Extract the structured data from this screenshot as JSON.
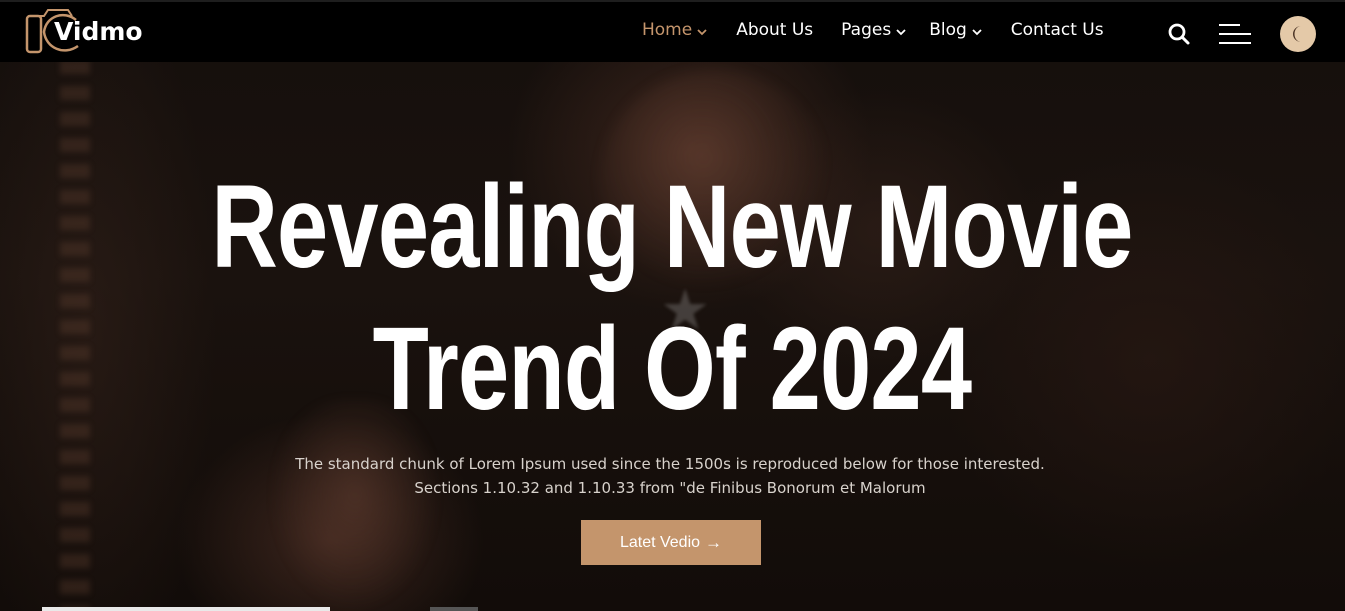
{
  "brand": {
    "name": "Vidmo",
    "accent_color": "#c4956c"
  },
  "nav": {
    "items": [
      {
        "label": "Home",
        "dropdown": true,
        "active": true
      },
      {
        "label": "About Us",
        "dropdown": false,
        "active": false
      },
      {
        "label": "Pages",
        "dropdown": true,
        "active": false
      },
      {
        "label": "Blog",
        "dropdown": true,
        "active": false
      },
      {
        "label": "Contact Us",
        "dropdown": false,
        "active": false
      }
    ],
    "icons": [
      "search-icon",
      "hamburger-menu-icon",
      "moon-icon"
    ]
  },
  "hero": {
    "title_line1": "Revealing New Movie",
    "title_line2": "Trend Of 2024",
    "description": "The standard chunk of Lorem Ipsum used since the 1500s is reproduced below for those interested. Sections 1.10.32 and 1.10.33 from \"de Finibus Bonorum et Malorum",
    "cta_label": "Latet Vedio",
    "cta_icon": "arrow-right-icon"
  }
}
